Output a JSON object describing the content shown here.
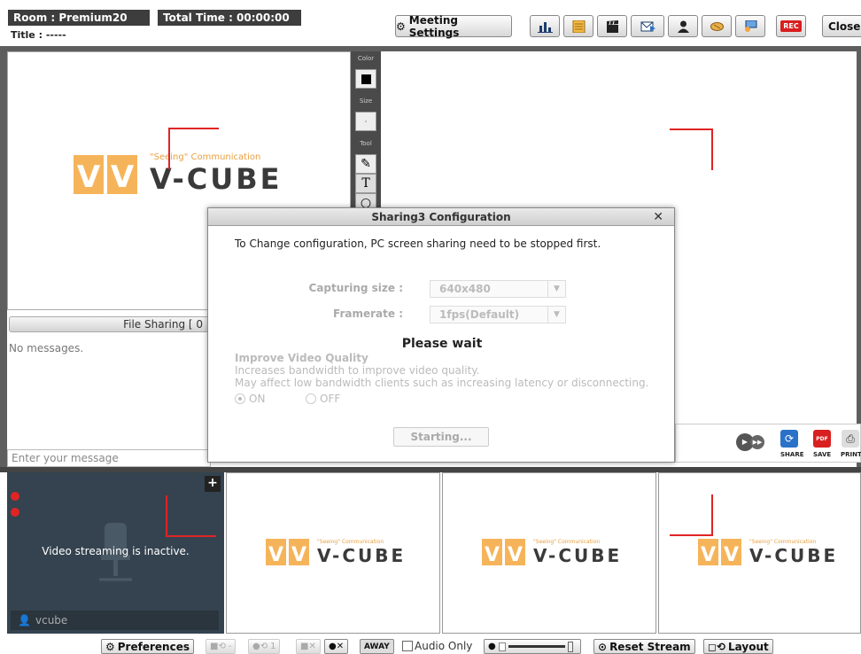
{
  "header": {
    "room": "Room : Premium20",
    "total_time": "Total Time : 00:00:00",
    "title": "Title : -----",
    "meeting_settings": "Meeting Settings",
    "close_label": "Close",
    "rec_label": "REC"
  },
  "whiteboard": {
    "color_label": "Color",
    "size_label": "Size",
    "tool_label": "Tool"
  },
  "logo": {
    "tagline": "\"Seeing\" Communication",
    "brand": "V-CUBE"
  },
  "chat": {
    "file_sharing": "File Sharing [ 0",
    "empty_msg": "No messages.",
    "input_placeholder": "Enter your message"
  },
  "dialog": {
    "title": "Sharing3 Configuration",
    "close": "✕",
    "message": "To Change configuration, PC screen sharing need to be stopped first.",
    "capturing_label": "Capturing size :",
    "capturing_value": "640x480",
    "framerate_label": "Framerate :",
    "framerate_value": "1fps(Default)",
    "wait": "Please wait",
    "ivq_title": "Improve Video Quality",
    "ivq_line1": "Increases bandwidth to improve video quality.",
    "ivq_line2": "May affect low bandwidth clients such as increasing latency or disconnecting.",
    "on": "ON",
    "off": "OFF",
    "start_btn": "Starting..."
  },
  "sharebar": {
    "share": "SHARE",
    "save": "SAVE",
    "print": "PRINT",
    "pdf": "PDF"
  },
  "self_video": {
    "inactive": "Video streaming is inactive.",
    "user": "vcube"
  },
  "bottom": {
    "preferences": "Preferences",
    "cam_minus": "-",
    "mic_1": "1",
    "away": "AWAY",
    "audio_only": "Audio Only",
    "reset_stream": "Reset Stream",
    "layout": "Layout"
  },
  "colors": {
    "accent_red": "#e02424",
    "logo_orange": "#f2a53e",
    "dark_bar": "#444444"
  }
}
